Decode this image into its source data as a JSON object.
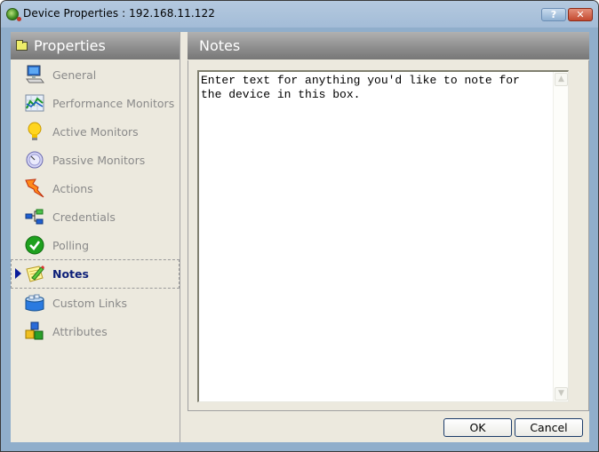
{
  "window": {
    "title": "Device Properties : 192.168.11.122",
    "app_icon": "network-device-icon",
    "help_button": "?",
    "close_button": "✕"
  },
  "sidebar": {
    "header": "Properties",
    "header_icon": "folder-icon",
    "items": [
      {
        "label": "General",
        "icon": "computer-icon",
        "selected": false
      },
      {
        "label": "Performance Monitors",
        "icon": "chart-icon",
        "selected": false
      },
      {
        "label": "Active Monitors",
        "icon": "lightbulb-icon",
        "selected": false
      },
      {
        "label": "Passive Monitors",
        "icon": "dish-icon",
        "selected": false
      },
      {
        "label": "Actions",
        "icon": "lightning-arrow-icon",
        "selected": false
      },
      {
        "label": "Credentials",
        "icon": "tree-nodes-icon",
        "selected": false
      },
      {
        "label": "Polling",
        "icon": "checkmark-icon",
        "selected": false
      },
      {
        "label": "Notes",
        "icon": "notepad-pencil-icon",
        "selected": true
      },
      {
        "label": "Custom Links",
        "icon": "links-icon",
        "selected": false
      },
      {
        "label": "Attributes",
        "icon": "cubes-icon",
        "selected": false
      }
    ]
  },
  "main": {
    "header": "Notes",
    "notes_value": "Enter text for anything you'd like to note for\nthe device in this box."
  },
  "buttons": {
    "ok": "OK",
    "cancel": "Cancel"
  },
  "colors": {
    "selected_text": "#0c1f78",
    "header_bg": "#8f8f8f",
    "window_frame": "#90aecb"
  }
}
